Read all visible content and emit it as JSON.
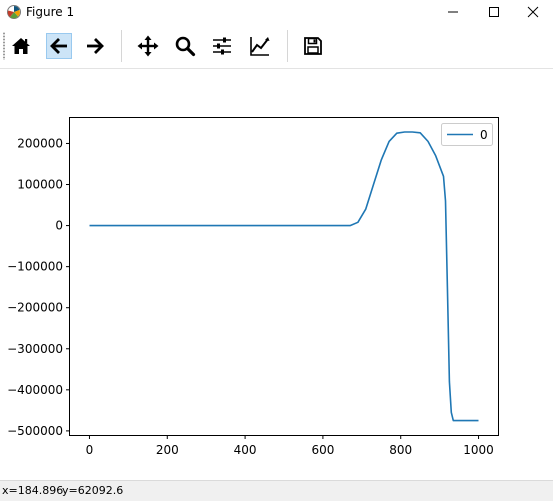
{
  "window": {
    "title": "Figure 1",
    "icons": {
      "app": "matplotlib-icon",
      "minimize": "minimize-icon",
      "maximize": "maximize-icon",
      "close": "close-icon"
    }
  },
  "toolbar": {
    "buttons": [
      {
        "name": "home-button",
        "icon": "home-icon",
        "tooltip": "Reset original view"
      },
      {
        "name": "back-button",
        "icon": "arrow-left-icon",
        "tooltip": "Back",
        "active": true
      },
      {
        "name": "forward-button",
        "icon": "arrow-right-icon",
        "tooltip": "Forward"
      },
      {
        "name": "pan-button",
        "icon": "move-icon",
        "tooltip": "Pan"
      },
      {
        "name": "zoom-button",
        "icon": "magnifier-icon",
        "tooltip": "Zoom"
      },
      {
        "name": "subplots-button",
        "icon": "sliders-icon",
        "tooltip": "Configure subplots"
      },
      {
        "name": "edit-axes-button",
        "icon": "chart-edit-icon",
        "tooltip": "Edit axis"
      },
      {
        "name": "save-button",
        "icon": "floppy-disk-icon",
        "tooltip": "Save the figure"
      }
    ]
  },
  "status": {
    "x_readout": "x=184.896",
    "y_readout": "y=62092.6"
  },
  "chart_data": {
    "type": "line",
    "title": "",
    "xlabel": "",
    "ylabel": "",
    "xlim": [
      -50,
      1050
    ],
    "ylim": [
      -510000,
      262000
    ],
    "x_ticks": [
      0,
      200,
      400,
      600,
      800,
      1000
    ],
    "x_tick_labels": [
      "0",
      "200",
      "400",
      "600",
      "800",
      "1000"
    ],
    "y_ticks": [
      200000,
      100000,
      0,
      -100000,
      -200000,
      -300000,
      -400000,
      -500000
    ],
    "y_tick_labels": [
      "200000",
      "100000",
      "0",
      "−100000",
      "−200000",
      "−300000",
      "−400000",
      "−500000"
    ],
    "grid": false,
    "legend": {
      "placement": "top-right",
      "entries": [
        "0"
      ]
    },
    "series": [
      {
        "name": "0",
        "color": "#1f77b4",
        "x": [
          0,
          100,
          200,
          300,
          400,
          500,
          600,
          670,
          690,
          710,
          730,
          750,
          770,
          790,
          810,
          830,
          850,
          870,
          890,
          910,
          915,
          920,
          925,
          930,
          935,
          940,
          1000
        ],
        "y": [
          0,
          0,
          0,
          0,
          0,
          0,
          0,
          0,
          8000,
          40000,
          100000,
          160000,
          205000,
          225000,
          228000,
          228000,
          226000,
          205000,
          170000,
          120000,
          60000,
          -150000,
          -380000,
          -455000,
          -475000,
          -475000,
          -475000
        ]
      }
    ]
  }
}
